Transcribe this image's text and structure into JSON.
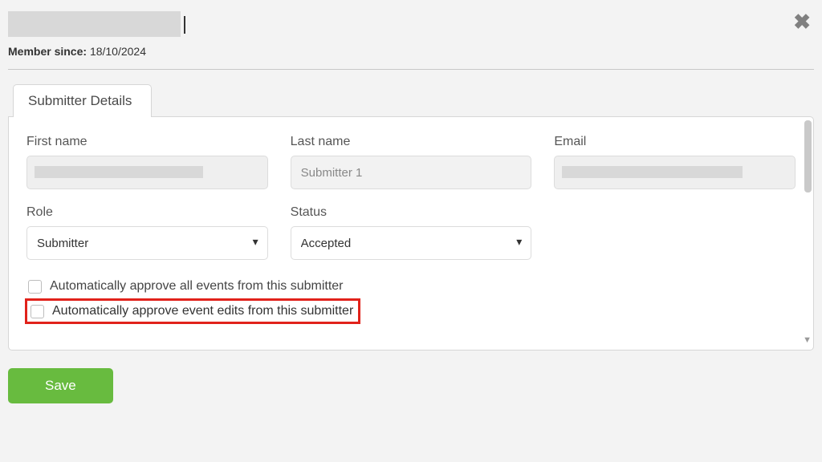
{
  "header": {
    "member_since_label": "Member since:",
    "member_since_value": "18/10/2024"
  },
  "tab": {
    "label": "Submitter Details"
  },
  "fields": {
    "first_name": {
      "label": "First name",
      "value": ""
    },
    "last_name": {
      "label": "Last name",
      "value": "Submitter 1"
    },
    "email": {
      "label": "Email",
      "value": ""
    },
    "role": {
      "label": "Role",
      "value": "Submitter"
    },
    "status": {
      "label": "Status",
      "value": "Accepted"
    }
  },
  "options": {
    "auto_approve_events": "Automatically approve all events from this submitter",
    "auto_approve_edits": "Automatically approve event edits from this submitter"
  },
  "actions": {
    "save": "Save"
  }
}
